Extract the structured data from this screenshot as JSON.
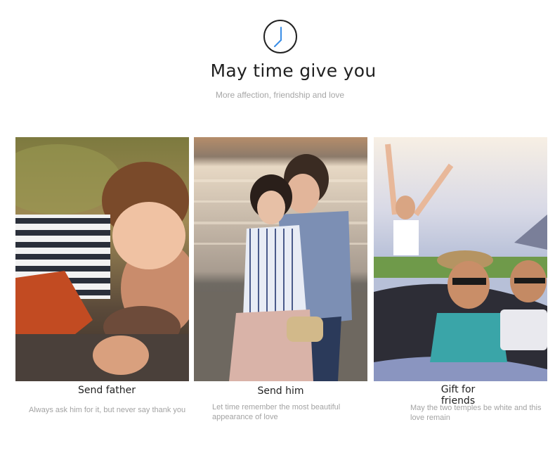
{
  "header": {
    "clock_icon": "clock-icon",
    "title": "May time give you",
    "subtitle": "More affection, friendship and love"
  },
  "cards": [
    {
      "image": "father-and-child-photo",
      "caption": "Send father",
      "description": "Always ask him for it, but never say thank you"
    },
    {
      "image": "couple-embracing-photo",
      "caption": "Send him",
      "description": "Let time remember the most beautiful appearance of love"
    },
    {
      "image": "friends-convertible-selfie-photo",
      "caption": "Gift for friends",
      "description": "May the two temples be white and this love remain"
    }
  ],
  "colors": {
    "clock_hands": "#3a8ee6",
    "clock_ring": "#222222",
    "title": "#1f1f1f",
    "muted_text": "#a3a3a3"
  }
}
